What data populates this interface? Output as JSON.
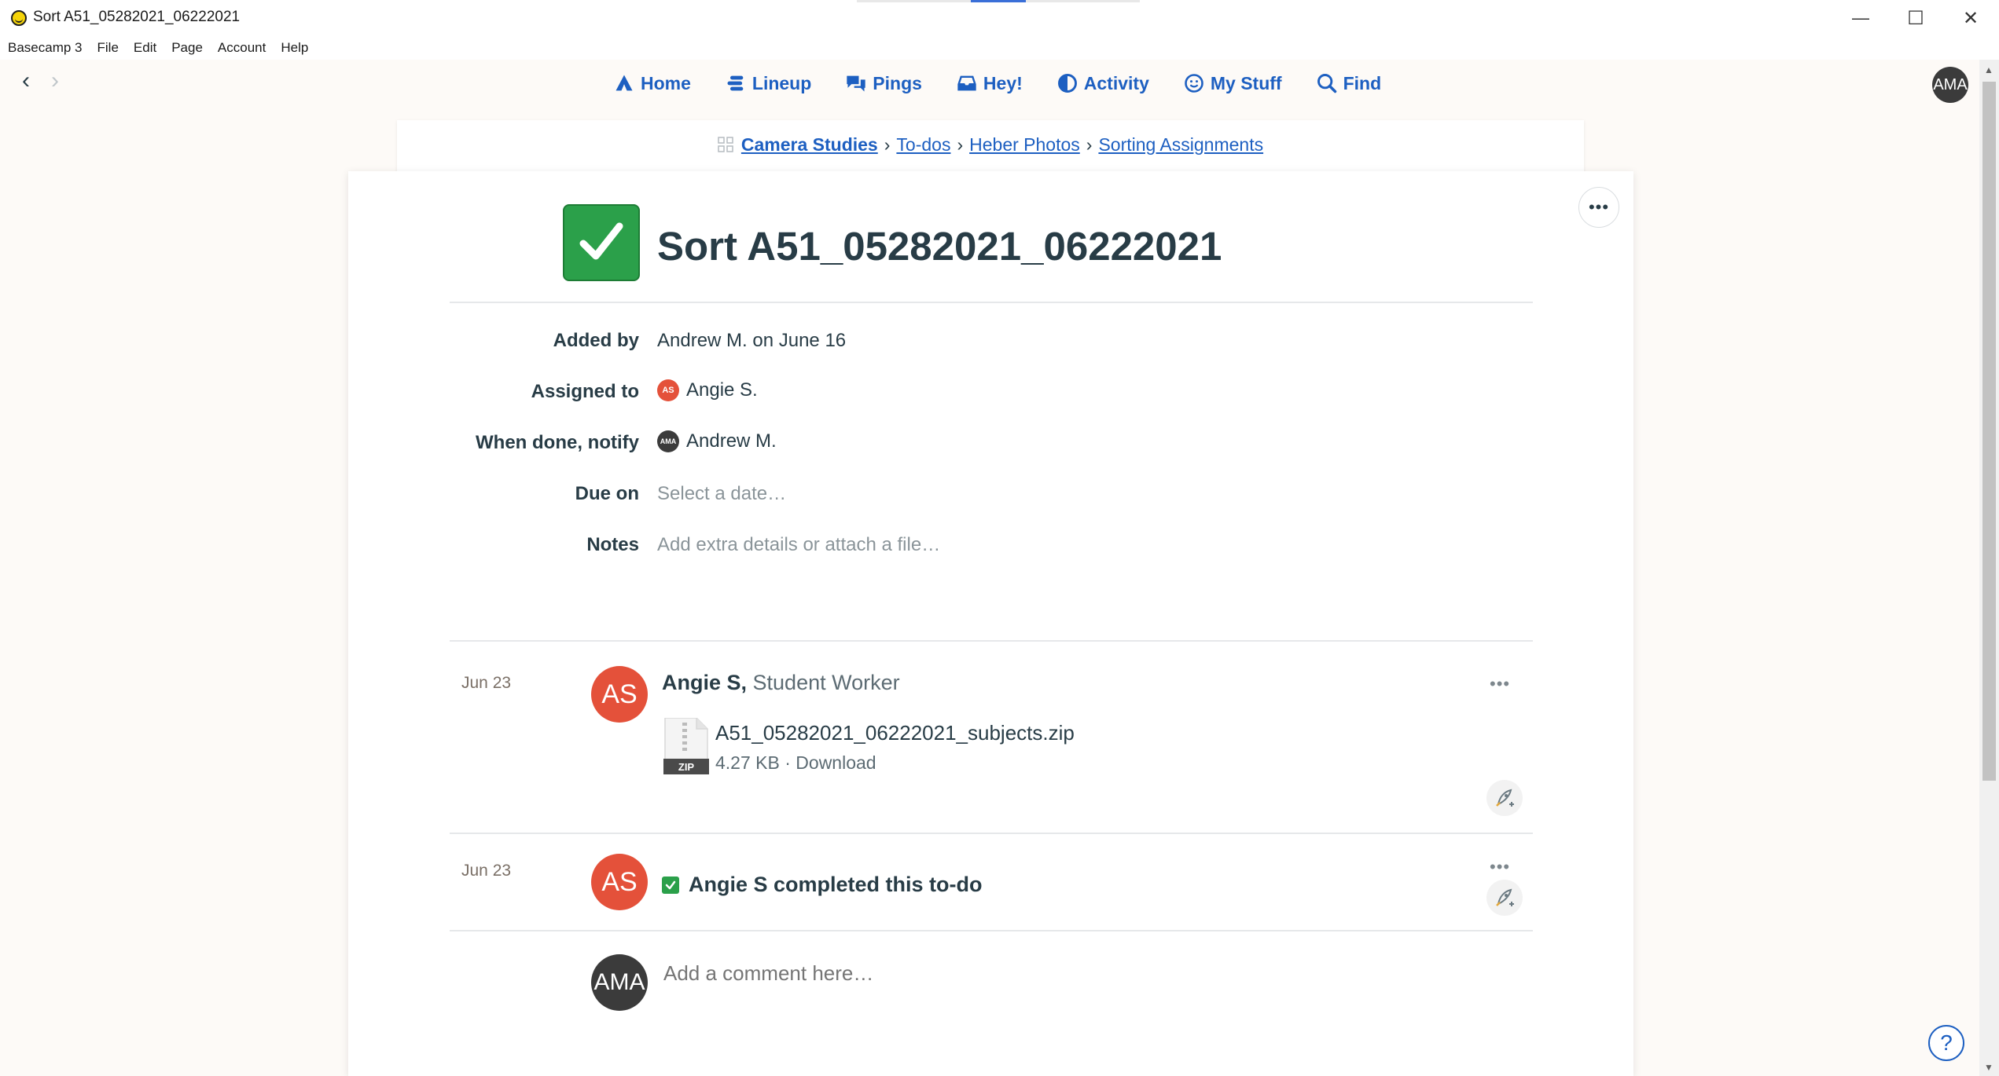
{
  "window": {
    "title": "Sort A51_05282021_06222021",
    "minimize_glyph": "—",
    "maximize_glyph": "☐",
    "close_glyph": "✕"
  },
  "menubar": {
    "items": [
      "Basecamp 3",
      "File",
      "Edit",
      "Page",
      "Account",
      "Help"
    ]
  },
  "nav": {
    "back_glyph": "‹",
    "forward_glyph": "›",
    "items": [
      {
        "label": "Home",
        "icon": "home-icon"
      },
      {
        "label": "Lineup",
        "icon": "lineup-icon"
      },
      {
        "label": "Pings",
        "icon": "pings-icon"
      },
      {
        "label": "Hey!",
        "icon": "hey-icon"
      },
      {
        "label": "Activity",
        "icon": "activity-icon"
      },
      {
        "label": "My Stuff",
        "icon": "my-stuff-icon"
      },
      {
        "label": "Find",
        "icon": "search-icon"
      }
    ],
    "user_initials": "AMA"
  },
  "breadcrumb": {
    "project": "Camera Studies",
    "items": [
      "To-dos",
      "Heber Photos",
      "Sorting Assignments"
    ],
    "separator": "›"
  },
  "todo": {
    "title": "Sort A51_05282021_06222021",
    "more_glyph": "•••",
    "fields": {
      "added_by_label": "Added by",
      "added_by_value": "Andrew M. on June 16",
      "assigned_label": "Assigned to",
      "assigned_initials": "AS",
      "assigned_value": "Angie S.",
      "notify_label": "When done, notify",
      "notify_initials": "AMA",
      "notify_value": "Andrew M.",
      "due_label": "Due on",
      "due_placeholder": "Select a date…",
      "notes_label": "Notes",
      "notes_placeholder": "Add extra details or attach a file…"
    }
  },
  "activity": [
    {
      "date": "Jun 23",
      "initials": "AS",
      "author": "Angie S,",
      "role": "Student Worker",
      "file_name": "A51_05282021_06222021_subjects.zip",
      "file_type": "ZIP",
      "file_size": "4.27 KB",
      "file_action": "Download",
      "meta_separator": "·"
    },
    {
      "date": "Jun 23",
      "initials": "AS",
      "text": "Angie S completed this to-do"
    }
  ],
  "comment": {
    "initials": "AMA",
    "placeholder": "Add a comment here…"
  },
  "help_glyph": "?",
  "colors": {
    "accent": "#1d5fc1",
    "complete_green": "#2ba04a",
    "avatar_red": "#e4513a",
    "avatar_dark": "#3b3b3b",
    "page_bg": "#fdfaf7"
  }
}
